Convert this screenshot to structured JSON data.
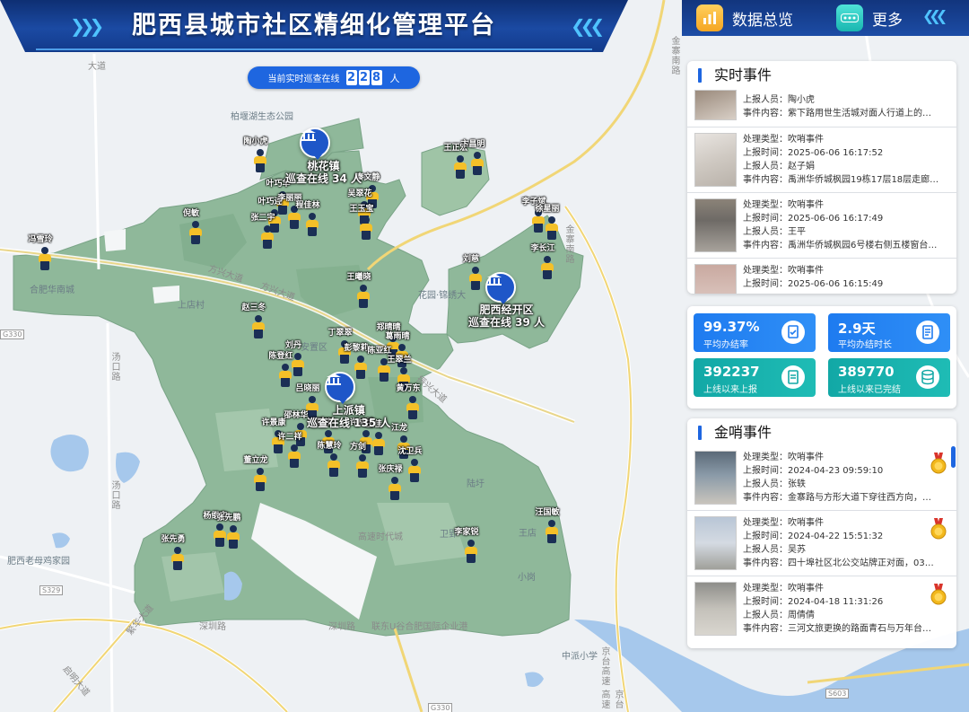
{
  "app": {
    "title": "肥西县城市社区精细化管理平台",
    "nav": [
      {
        "label": "数据总览",
        "icon": "bar-chart-icon"
      },
      {
        "label": "更多",
        "icon": "more-dots-icon"
      }
    ]
  },
  "online_counter": {
    "prefix": "当前实时巡查在线",
    "digits": [
      "2",
      "2",
      "8"
    ],
    "unit": "人",
    "count": 228
  },
  "map": {
    "districts": [
      {
        "name": "桃花镇",
        "online_text": "巡查在线 34 人",
        "online": 34
      },
      {
        "name": "肥西经开区",
        "online_text": "巡查在线 39 人",
        "online": 39
      },
      {
        "name": "上派镇",
        "online_text": "巡查在线 135 人",
        "online": 135
      }
    ],
    "place_labels": [
      "柏堰湖生态公园",
      "合肥华南城",
      "花园·锦绣大",
      "肥西老母鸡家园",
      "中派小学",
      "上店村",
      "安置区",
      "小岗",
      "王店",
      "陆圩",
      "卫郢"
    ],
    "road_labels": [
      "方兴大道",
      "方兴大道",
      "汤口路",
      "汤口路",
      "金寨南路",
      "深圳路",
      "深圳路",
      "联东U谷合肥国际企业港",
      "高速时代城",
      "京台高速",
      "京台高速",
      "金寨南路",
      "繁华大道",
      "振兴大道",
      "启明大道",
      "大道",
      "G330",
      "S329",
      "G330",
      "S603"
    ],
    "patrol_names": [
      "陶小虎",
      "叶巧华",
      "叶巧连",
      "李丽丽",
      "程佳林",
      "张二宇",
      "倪敏",
      "冯雪玲",
      "赵三冬",
      "刘丹",
      "陈登红",
      "王正宏",
      "卞昌明",
      "秦文静",
      "吴翠花",
      "王玉宝",
      "李子斌",
      "徐星丽",
      "刘慈",
      "李长江",
      "王曦晓",
      "郑晴晴",
      "葛雨晴",
      "丁翠翠",
      "彭黎莉",
      "陈亚红",
      "王翠兰",
      "黄万东",
      "吕晓丽",
      "邵林华",
      "吴佳",
      "许林林",
      "王佳",
      "江龙",
      "许景康",
      "许二祥",
      "陈慧玲",
      "方剑",
      "沈卫兵",
      "张庆禄",
      "董立龙",
      "杨继宝",
      "张先勇",
      "张先鹏",
      "李家锐",
      "汪国敏"
    ]
  },
  "realtime_events": {
    "title": "实时事件",
    "items": [
      {
        "lines": [
          "上报人员：陶小虎",
          "事件内容：紫下路用世生活城对面人行道上的…"
        ]
      },
      {
        "lines": [
          "处理类型：吹哨事件",
          "上报时间：2025-06-06 16:17:52",
          "上报人员：赵子娟",
          "事件内容：禹洲华侨城枫园19栋17层18层走廊…"
        ]
      },
      {
        "lines": [
          "处理类型：吹哨事件",
          "上报时间：2025-06-06 16:17:49",
          "上报人员：王平",
          "事件内容：禹洲华侨城枫园6号楼右侧五楼窗台…"
        ]
      },
      {
        "lines": [
          "处理类型：吹哨事件",
          "上报时间：2025-06-06 16:15:49"
        ]
      }
    ]
  },
  "stats": [
    {
      "value": "99.37%",
      "label": "平均办结率",
      "color": "blue",
      "icon": "clipboard-check-icon"
    },
    {
      "value": "2.9天",
      "label": "平均办结时长",
      "color": "blue",
      "icon": "document-list-icon"
    },
    {
      "value": "392237",
      "label": "上线以来上报",
      "color": "teal",
      "icon": "report-doc-icon"
    },
    {
      "value": "389770",
      "label": "上线以来已完结",
      "color": "teal",
      "icon": "database-icon"
    }
  ],
  "whistle_events": {
    "title": "金哨事件",
    "items": [
      {
        "lines": [
          "处理类型：吹哨事件",
          "上报时间：2024-04-23 09:59:10",
          "上报人员：张轶",
          "事件内容：金寨路与方形大道下穿往西方向，…"
        ]
      },
      {
        "lines": [
          "处理类型：吹哨事件",
          "上报时间：2024-04-22 15:51:32",
          "上报人员：吴苏",
          "事件内容：四十埠社区北公交站牌正对面，03…"
        ]
      },
      {
        "lines": [
          "处理类型：吹哨事件",
          "上报时间：2024-04-18 11:31:26",
          "上报人员：周倩倩",
          "事件内容：三河文旅更换的路面青石与万年台…"
        ]
      }
    ]
  },
  "colors": {
    "header_blue": "#1b4aa3",
    "accent_blue": "#1e66e0",
    "teal": "#12a8a6",
    "district_green": "#8fb89a",
    "marker_yellow": "#f4c028"
  }
}
